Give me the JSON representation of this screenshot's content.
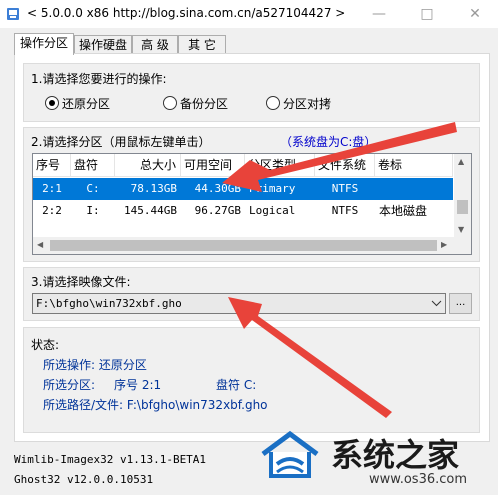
{
  "window": {
    "title": "< 5.0.0.0 x86 http://blog.sina.com.cn/a527104427 >",
    "min_icon": "minimize-icon",
    "max_icon": "maximize-icon",
    "close_icon": "close-icon"
  },
  "tabs": [
    {
      "label": "操作分区",
      "active": true
    },
    {
      "label": "操作硬盘",
      "active": false
    },
    {
      "label": "高 级",
      "active": false
    },
    {
      "label": "其 它",
      "active": false
    }
  ],
  "operation": {
    "label": "1.请选择您要进行的操作:",
    "options": [
      {
        "label": "还原分区",
        "checked": true
      },
      {
        "label": "备份分区",
        "checked": false
      },
      {
        "label": "分区对拷",
        "checked": false
      }
    ]
  },
  "partition": {
    "label": "2.请选择分区（用鼠标左键单击）",
    "system_disk_note": "（系统盘为C:盘）",
    "columns": [
      "序号",
      "盘符",
      "总大小",
      "可用空间",
      "分区类型",
      "文件系统",
      "卷标"
    ],
    "rows": [
      {
        "index": "2:1",
        "drive": "C:",
        "total": "78.13GB",
        "free": "44.30GB",
        "type": "Primary",
        "fs": "NTFS",
        "volume": "",
        "selected": true
      },
      {
        "index": "2:2",
        "drive": "I:",
        "total": "145.44GB",
        "free": "96.27GB",
        "type": "Logical",
        "fs": "NTFS",
        "volume": "本地磁盘",
        "selected": false
      }
    ]
  },
  "image": {
    "label": "3.请选择映像文件:",
    "path": "F:\\bfgho\\win732xbf.gho",
    "browse_label": "..."
  },
  "status": {
    "title": "状态:",
    "op_label": "所选操作: 还原分区",
    "part_label": "所选分区:",
    "part_index": "序号 2:1",
    "drive_label": "盘符 C:",
    "path_label": "所选路径/文件: F:\\bfgho\\win732xbf.gho"
  },
  "footer": {
    "wimlib": "Wimlib-Imagex32 v1.13.1-BETA1",
    "ghost": "Ghost32 v12.0.0.10531"
  },
  "watermark": {
    "brand": "系统之家",
    "url": "www.os36.com"
  },
  "colors": {
    "selection": "#0078d7",
    "note_blue": "#0000cc",
    "status_blue": "#003399",
    "arrow_red": "#e8433a"
  }
}
